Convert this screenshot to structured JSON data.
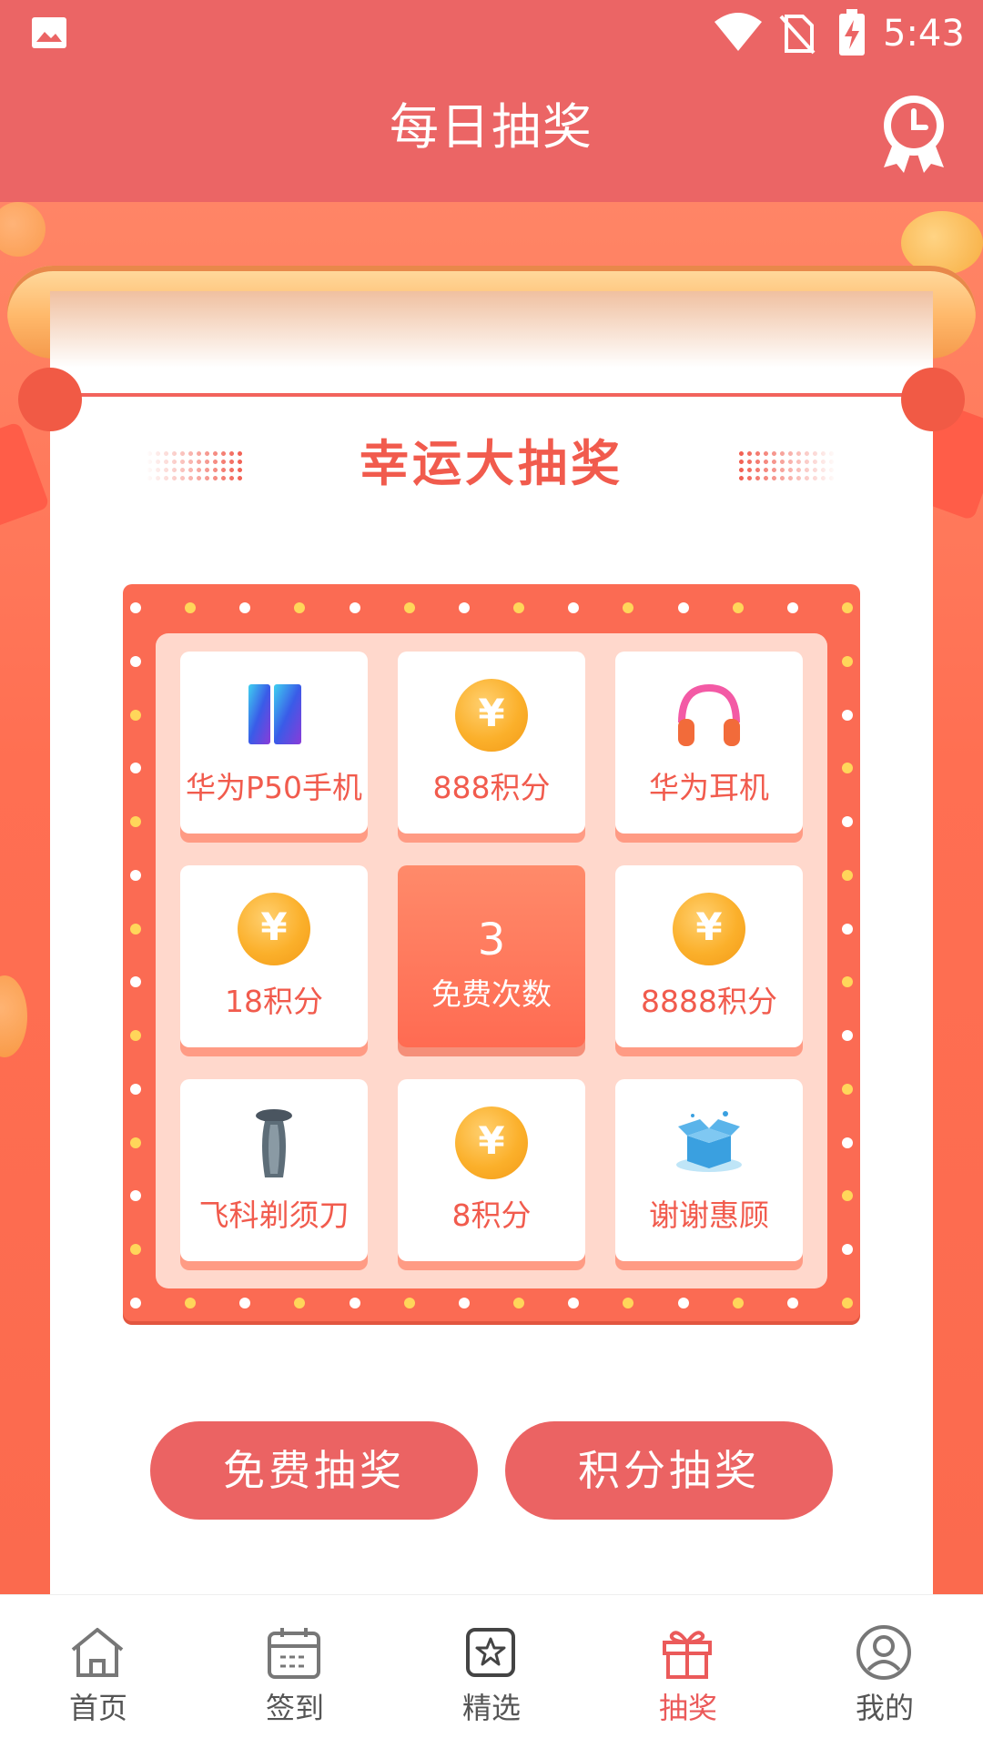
{
  "status_bar": {
    "time": "5:43"
  },
  "header": {
    "title": "每日抽奖",
    "history_icon": "medal-clock-icon"
  },
  "lottery": {
    "title": "幸运大抽奖",
    "prizes": [
      {
        "label": "华为P50手机",
        "icon": "phone-icon"
      },
      {
        "label": "888积分",
        "icon": "coin-icon"
      },
      {
        "label": "华为耳机",
        "icon": "headphones-icon"
      },
      {
        "label": "18积分",
        "icon": "coin-icon"
      },
      {
        "label": "8888积分",
        "icon": "coin-icon"
      },
      {
        "label": "飞科剃须刀",
        "icon": "shaver-icon"
      },
      {
        "label": "8积分",
        "icon": "coin-icon"
      },
      {
        "label": "谢谢惠顾",
        "icon": "empty-box-icon"
      }
    ],
    "center": {
      "count": "3",
      "label": "免费次数"
    },
    "coin_symbol": "¥"
  },
  "buttons": {
    "free_draw": "免费抽奖",
    "points_draw": "积分抽奖"
  },
  "tabbar": {
    "items": [
      {
        "label": "首页",
        "icon": "home-icon"
      },
      {
        "label": "签到",
        "icon": "calendar-icon"
      },
      {
        "label": "精选",
        "icon": "star-icon"
      },
      {
        "label": "抽奖",
        "icon": "gift-icon",
        "active": true
      },
      {
        "label": "我的",
        "icon": "user-icon"
      }
    ]
  },
  "colors": {
    "primary": "#eb6565",
    "board": "#fb6b53",
    "accent_text": "#f15b4d"
  }
}
